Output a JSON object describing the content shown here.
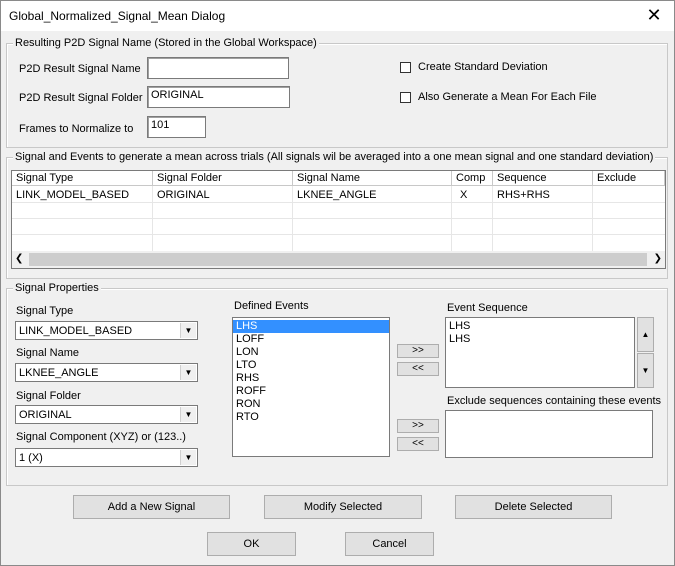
{
  "window": {
    "title": "Global_Normalized_Signal_Mean Dialog",
    "close_glyph": "✕"
  },
  "result_group": {
    "label": "Resulting P2D Signal Name (Stored in the Global Workspace)",
    "result_name_label": "P2D Result Signal Name",
    "result_name_value": "",
    "result_folder_label": "P2D Result Signal Folder",
    "result_folder_value": "ORIGINAL",
    "frames_label": "Frames to Normalize to",
    "frames_value": "101",
    "std_dev_label": "Create Standard Deviation",
    "mean_each_file_label": "Also Generate a Mean For Each File"
  },
  "signals_group": {
    "label": "Signal and Events to generate a mean across trials (All signals wil be averaged into a one mean signal and one standard deviation)",
    "columns": [
      "Signal Type",
      "Signal Folder",
      "Signal Name",
      "Comp",
      "Sequence",
      "Exclude"
    ],
    "rows": [
      [
        "LINK_MODEL_BASED",
        "ORIGINAL",
        "LKNEE_ANGLE",
        "X",
        "RHS+RHS",
        ""
      ]
    ]
  },
  "properties_group": {
    "label": "Signal Properties",
    "signal_type_label": "Signal Type",
    "signal_type_value": "LINK_MODEL_BASED",
    "signal_name_label": "Signal Name",
    "signal_name_value": "LKNEE_ANGLE",
    "signal_folder_label": "Signal Folder",
    "signal_folder_value": "ORIGINAL",
    "component_label": "Signal Component (XYZ) or (123..)",
    "component_value": "1 (X)",
    "defined_events_label": "Defined Events",
    "defined_events": [
      "LHS",
      "LOFF",
      "LON",
      "LTO",
      "RHS",
      "ROFF",
      "RON",
      "RTO"
    ],
    "event_sequence_label": "Event Sequence",
    "event_sequence": [
      "LHS",
      "LHS"
    ],
    "exclude_label": "Exclude sequences containing these events",
    "add_arrow": ">>",
    "remove_arrow": "<<"
  },
  "buttons": {
    "add": "Add a New Signal",
    "modify": "Modify Selected",
    "delete": "Delete Selected",
    "ok": "OK",
    "cancel": "Cancel"
  }
}
